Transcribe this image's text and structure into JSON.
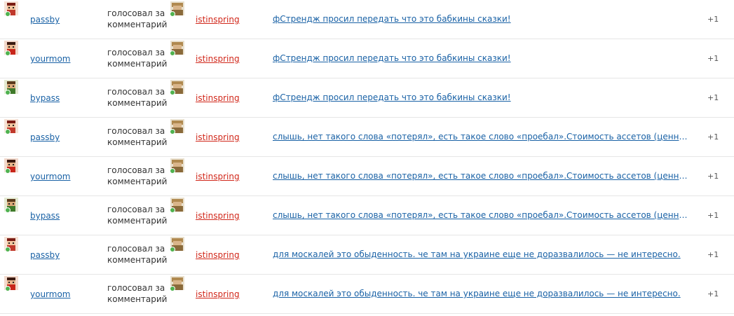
{
  "rows": [
    {
      "user": "passby",
      "action": "голосовал за комментарий",
      "target": "istinspring",
      "comment": "фСтрендж просил передать что это бабкины сказки!",
      "score": "+1",
      "avatar": "female-pixel-avatar"
    },
    {
      "user": "yourmom",
      "action": "голосовал за комментарий",
      "target": "istinspring",
      "comment": "фСтрендж просил передать что это бабкины сказки!",
      "score": "+1",
      "avatar": "red-pixel-avatar"
    },
    {
      "user": "bypass",
      "action": "голосовал за комментарий",
      "target": "istinspring",
      "comment": "фСтрендж просил передать что это бабкины сказки!",
      "score": "+1",
      "avatar": "green-pixel-avatar"
    },
    {
      "user": "passby",
      "action": "голосовал за комментарий",
      "target": "istinspring",
      "comment": "слышь, нет такого слова «потерял», есть такое слово «проебал».Стоимость ассетов (ценных бумаг) упала",
      "score": "+1",
      "avatar": "female-pixel-avatar"
    },
    {
      "user": "yourmom",
      "action": "голосовал за комментарий",
      "target": "istinspring",
      "comment": "слышь, нет такого слова «потерял», есть такое слово «проебал».Стоимость ассетов (ценных бумаг) упала",
      "score": "+1",
      "avatar": "red-pixel-avatar"
    },
    {
      "user": "bypass",
      "action": "голосовал за комментарий",
      "target": "istinspring",
      "comment": "слышь, нет такого слова «потерял», есть такое слово «проебал».Стоимость ассетов (ценных бумаг) упала",
      "score": "+1",
      "avatar": "green-pixel-avatar"
    },
    {
      "user": "passby",
      "action": "голосовал за комментарий",
      "target": "istinspring",
      "comment": "для москалей это обыденность. че там на украине еще не доразвалилось —  не интересно.",
      "score": "+1",
      "avatar": "female-pixel-avatar"
    },
    {
      "user": "yourmom",
      "action": "голосовал за комментарий",
      "target": "istinspring",
      "comment": "для москалей это обыденность. че там на украине еще не доразвалилось —  не интересно.",
      "score": "+1",
      "avatar": "red-pixel-avatar"
    }
  ],
  "colors": {
    "link": "#1a62a6",
    "target_user": "#d1271a",
    "online": "#4fb24f",
    "divider": "#e6e6e6"
  }
}
